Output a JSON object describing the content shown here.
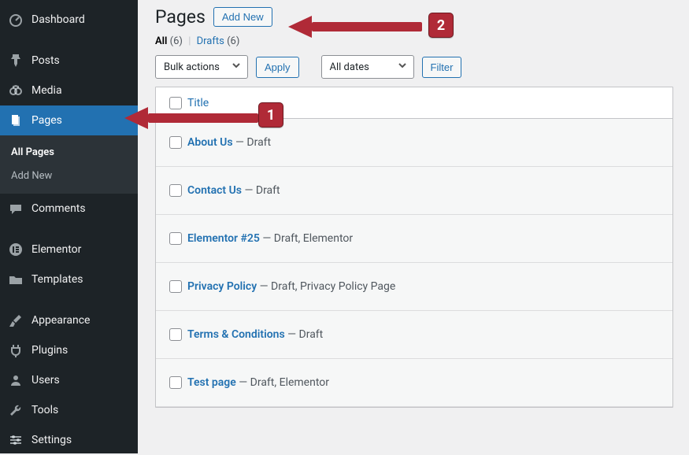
{
  "sidebar": {
    "items": [
      {
        "name": "dashboard",
        "label": "Dashboard",
        "icon": "speedometer"
      },
      {
        "name": "posts",
        "label": "Posts",
        "icon": "pin"
      },
      {
        "name": "media",
        "label": "Media",
        "icon": "media"
      },
      {
        "name": "pages",
        "label": "Pages",
        "icon": "page",
        "current": true
      },
      {
        "name": "comments",
        "label": "Comments",
        "icon": "comment"
      },
      {
        "name": "elementor",
        "label": "Elementor",
        "icon": "circle-e"
      },
      {
        "name": "templates",
        "label": "Templates",
        "icon": "folder"
      },
      {
        "name": "appearance",
        "label": "Appearance",
        "icon": "brush"
      },
      {
        "name": "plugins",
        "label": "Plugins",
        "icon": "plug"
      },
      {
        "name": "users",
        "label": "Users",
        "icon": "user"
      },
      {
        "name": "tools",
        "label": "Tools",
        "icon": "wrench"
      },
      {
        "name": "settings",
        "label": "Settings",
        "icon": "sliders"
      }
    ],
    "sub": {
      "all_pages": "All Pages",
      "add_new": "Add New"
    }
  },
  "header": {
    "title_label": "Pages",
    "add_new_label": "Add New"
  },
  "filters": {
    "all_label": "All",
    "all_count": "(6)",
    "drafts_label": "Drafts",
    "drafts_count": "(6)"
  },
  "controls": {
    "bulk_label": "Bulk actions",
    "apply_label": "Apply",
    "dates_label": "All dates",
    "filter_label": "Filter"
  },
  "table": {
    "col_title_label": "Title",
    "rows": [
      {
        "title": "About Us",
        "state": " — Draft"
      },
      {
        "title": "Contact Us",
        "state": " — Draft"
      },
      {
        "title": "Elementor #25",
        "state": " — Draft, Elementor"
      },
      {
        "title": "Privacy Policy",
        "state": " — Draft, Privacy Policy Page"
      },
      {
        "title": "Terms & Conditions",
        "state": " — Draft"
      },
      {
        "title": "Test page",
        "state": " — Draft, Elementor"
      }
    ]
  },
  "annotations": {
    "badge1": "1",
    "badge2": "2"
  }
}
